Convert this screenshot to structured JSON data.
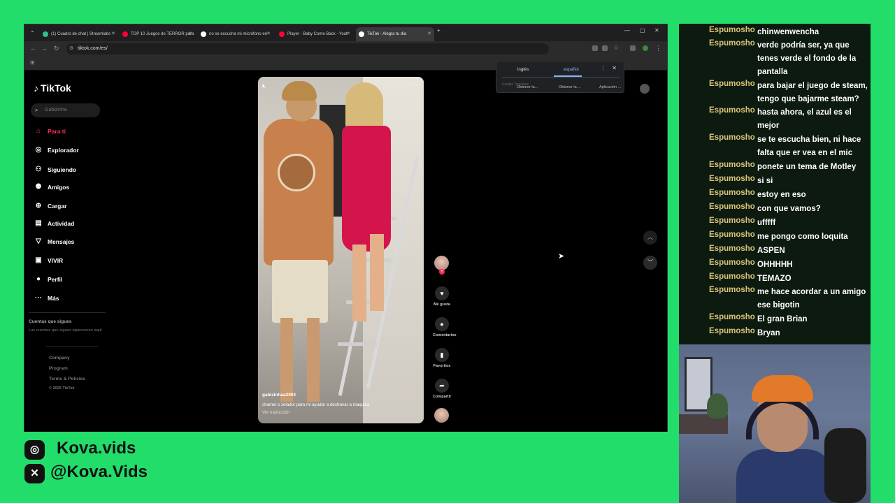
{
  "browser": {
    "tabs": [
      {
        "label": "(1) Cuadro de chat | Streamlabs",
        "favicon_color": "#2fbf8f"
      },
      {
        "label": "TOP 10 Juegos de TERROR para",
        "favicon_color": "#ff0033"
      },
      {
        "label": "no se escucha mi micrófono en",
        "favicon_color": "#ffffff"
      },
      {
        "label": "Player - Baby Come Back - Yout",
        "favicon_color": "#ff0033"
      },
      {
        "label": "TikTok - Alegra tu día",
        "favicon_color": "#ffffff"
      }
    ],
    "url": "tiktok.com/es/"
  },
  "translate_popup": {
    "lang_from": "inglés",
    "lang_to": "español",
    "provider": "Google Translate",
    "ext_items": [
      "Obtener la...",
      "Obtener la ...",
      "Aplicación ..."
    ]
  },
  "tiktok": {
    "logo": "TikTok",
    "search_placeholder": "Gabizinha",
    "menu": [
      {
        "label": "Para ti",
        "icon": "home-icon",
        "active": true
      },
      {
        "label": "Explorador",
        "icon": "compass-icon"
      },
      {
        "label": "Siguiendo",
        "icon": "following-icon"
      },
      {
        "label": "Amigos",
        "icon": "friends-icon"
      },
      {
        "label": "Cargar",
        "icon": "upload-icon"
      },
      {
        "label": "Actividad",
        "icon": "activity-icon"
      },
      {
        "label": "Mensajes",
        "icon": "messages-icon"
      },
      {
        "label": "VIVIR",
        "icon": "live-icon"
      },
      {
        "label": "Perfil",
        "icon": "profile-icon"
      },
      {
        "label": "Más",
        "icon": "more-icon"
      }
    ],
    "following_title": "Cuentas que sigues",
    "following_desc": "Las cuentas que sigues aparecerán aquí",
    "footer": [
      "Company",
      "Program",
      "Terms & Policies",
      "© 2025 TikTok"
    ],
    "video": {
      "username": "gabizinhaa2903",
      "caption": "chamei o zelador para mi ayudar a destravar a maquina",
      "translate_link": "Ver traducción"
    },
    "actions": [
      {
        "label": "Me gusta",
        "icon": "heart-icon"
      },
      {
        "label": "Comentarios",
        "icon": "comment-icon"
      },
      {
        "label": "Favoritos",
        "icon": "bookmark-icon"
      },
      {
        "label": "Compartir",
        "icon": "share-icon"
      }
    ]
  },
  "chat": {
    "user_color": "#d9c47a",
    "messages": [
      {
        "user": "Espumosho",
        "text": "chinwenwencha"
      },
      {
        "user": "Espumosho",
        "text": "verde podría ser, ya que tenes verde el fondo de la pantalla"
      },
      {
        "user": "Espumosho",
        "text": "para bajar el juego de steam, tengo que bajarme steam?"
      },
      {
        "user": "Espumosho",
        "text": "hasta ahora, el azul es el mejor"
      },
      {
        "user": "Espumosho",
        "text": "se te escucha bien, ni hace falta que er vea en el mic"
      },
      {
        "user": "Espumosho",
        "text": "ponete un tema de Motley"
      },
      {
        "user": "Espumosho",
        "text": "si si"
      },
      {
        "user": "Espumosho",
        "text": "estoy en eso"
      },
      {
        "user": "Espumosho",
        "text": "con que vamos?"
      },
      {
        "user": "Espumosho",
        "text": "ufffff"
      },
      {
        "user": "Espumosho",
        "text": "me pongo como loquita"
      },
      {
        "user": "Espumosho",
        "text": "ASPEN"
      },
      {
        "user": "Espumosho",
        "text": "OHHHHH"
      },
      {
        "user": "Espumosho",
        "text": "TEMAZO"
      },
      {
        "user": "Espumosho",
        "text": "me hace acordar a un amigo ese bigotin"
      },
      {
        "user": "Espumosho",
        "text": "El gran Brian"
      },
      {
        "user": "Espumosho",
        "text": "Bryan"
      }
    ]
  },
  "socials": [
    {
      "icon": "instagram-icon",
      "handle": "Kova.vids"
    },
    {
      "icon": "x-icon",
      "handle": "@Kova.Vids"
    }
  ],
  "colors": {
    "background": "#22dd6a",
    "tiktok_accent": "#fe2c55"
  }
}
